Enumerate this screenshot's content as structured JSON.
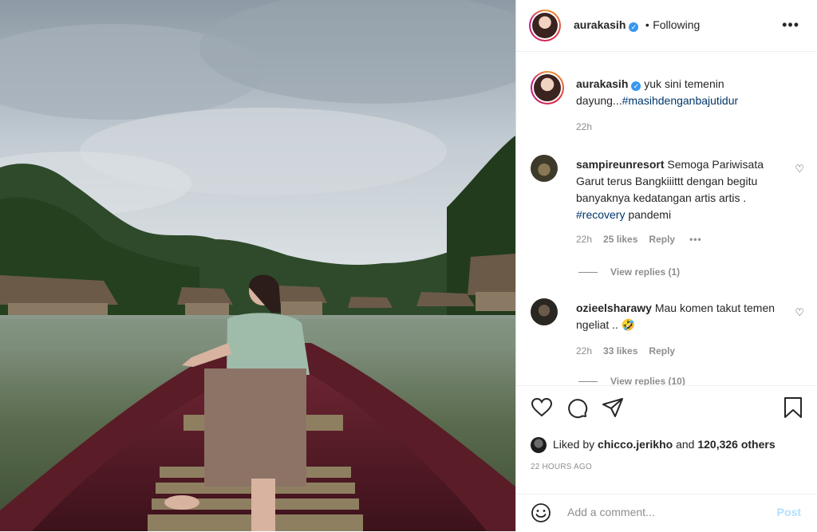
{
  "post": {
    "username": "aurakasih",
    "follow_status": "Following",
    "more_icon": "more-horizontal-icon",
    "caption_text": "yuk sini temenin dayung...",
    "caption_hashtag": "#masihdenganbajutidur",
    "caption_time": "22h"
  },
  "comments": [
    {
      "username": "sampireunresort",
      "text": "Semoga Pariwisata Garut terus Bangkiiittt dengan begitu banyaknya kedatangan artis artis . ",
      "hashtag": "#recovery",
      "text_after": " pandemi",
      "time": "22h",
      "likes": "25 likes",
      "reply_label": "Reply",
      "view_replies": "View replies (1)"
    },
    {
      "username": "ozieelsharawy",
      "text": "Mau komen takut temen ngeliat .. ",
      "emoji": "🤣",
      "time": "22h",
      "likes": "33 likes",
      "reply_label": "Reply",
      "view_replies": "View replies (10)"
    }
  ],
  "liked_by": {
    "prefix": "Liked by ",
    "user": "chicco.jerikho",
    "middle": " and ",
    "count": "120,326 others"
  },
  "timestamp": "22 HOURS AGO",
  "comment_box": {
    "placeholder": "Add a comment...",
    "post_label": "Post"
  },
  "icons": [
    "heart-icon",
    "comment-icon",
    "share-icon",
    "bookmark-icon",
    "emoji-icon",
    "verified-badge-icon"
  ],
  "colors": {
    "link": "#00376b",
    "muted": "#8e8e8e",
    "verified": "#3897f0",
    "post_disabled": "#b2dffc"
  }
}
